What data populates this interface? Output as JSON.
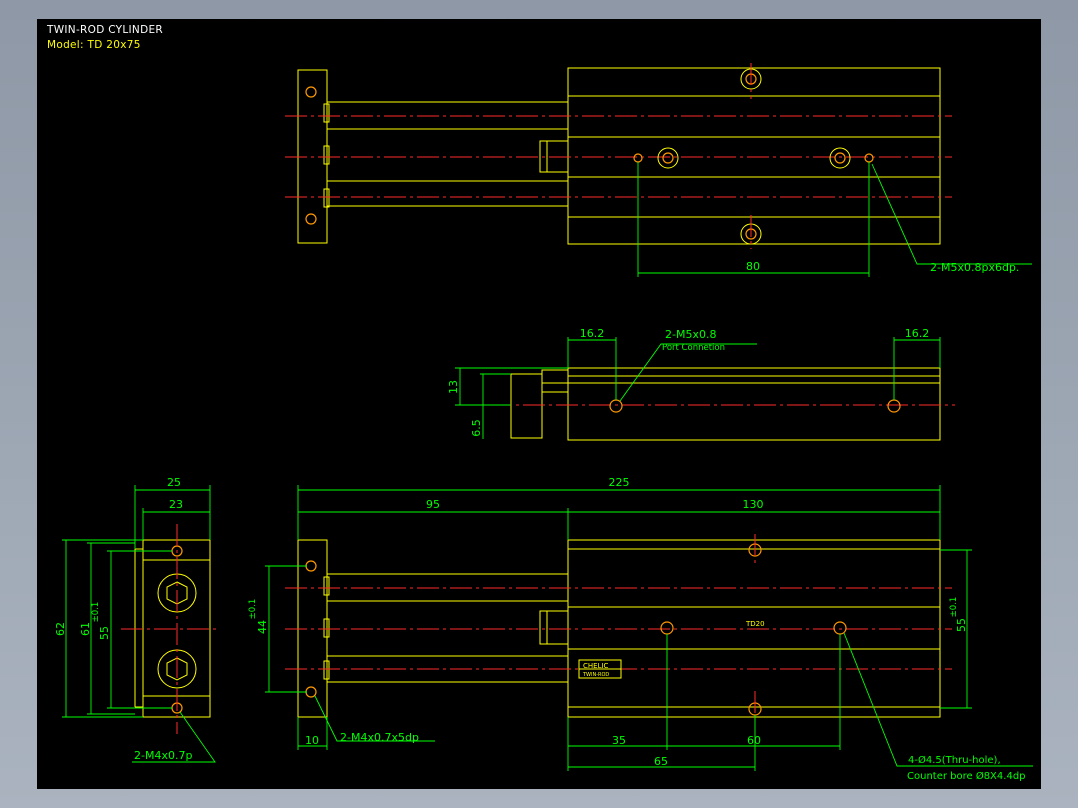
{
  "drawing": {
    "title": "TWIN-ROD CYLINDER",
    "model": "Model: TD 20x75"
  },
  "dimensions": {
    "top_80": "80",
    "top_note": "2-M5x0.8px6dp.",
    "mid_162_left": "16.2",
    "mid_162_right": "16.2",
    "mid_port": "2-M5x0.8",
    "mid_port_sub": "Port Connetion",
    "mid_13": "13",
    "mid_65": "6.5",
    "side_25": "25",
    "side_23": "23",
    "side_62": "62",
    "side_61": "61",
    "side_55": "55",
    "side_tol": "±0.1",
    "side_note": "2-M4x0.7p",
    "main_225": "225",
    "main_95": "95",
    "main_130": "130",
    "main_44": "44",
    "main_55": "55",
    "main_tol": "±0.1",
    "main_10": "10",
    "main_m4": "2-M4x0.7x5dp",
    "main_35": "35",
    "main_60": "60",
    "main_65": "65",
    "main_note1": "4-Ø4.5(Thru-hole),",
    "main_note2": "Counter bore Ø8X4.4dp"
  },
  "labels": {
    "model_mark": "TD20",
    "brand": "CHELIC",
    "plate": "TWIN-ROD"
  },
  "colors": {
    "background": "#000000",
    "outline": "#ffff00",
    "centerline": "#ff2a2a",
    "dimension": "#00ff00",
    "hole": "#ff9900"
  }
}
